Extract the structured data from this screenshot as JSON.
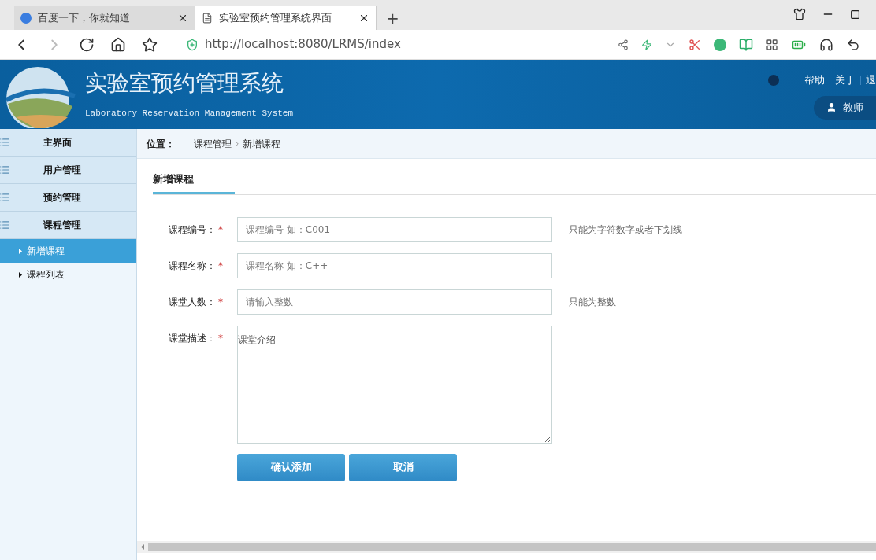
{
  "browser": {
    "tabs": [
      {
        "title": "百度一下，你就知道",
        "selected": false
      },
      {
        "title": "实验室预约管理系统界面",
        "selected": true
      }
    ],
    "new_tab": "+",
    "url": "http://localhost:8080/LRMS/index"
  },
  "header": {
    "title": "实验室预约管理系统",
    "subtitle": "Laboratory Reservation Management System",
    "links": [
      "帮助",
      "关于",
      "退"
    ],
    "user": "教师"
  },
  "sidebar": {
    "items": [
      {
        "label": "主界面",
        "kind": "section",
        "selected": false
      },
      {
        "label": "用户管理",
        "kind": "section",
        "selected": false
      },
      {
        "label": "预约管理",
        "kind": "section",
        "selected": false
      },
      {
        "label": "课程管理",
        "kind": "section",
        "selected": false
      },
      {
        "label": "新增课程",
        "kind": "sub",
        "selected": true
      },
      {
        "label": "课程列表",
        "kind": "sub",
        "selected": false
      }
    ]
  },
  "breadcrumb": {
    "label": "位置：",
    "items": [
      "课程管理",
      "新增课程"
    ]
  },
  "panel": {
    "title": "新增课程"
  },
  "form": {
    "fields": [
      {
        "label": "课程编号：",
        "required": "*",
        "kind": "input",
        "placeholder": "课程编号 如：C001",
        "hint": "只能为字符数字或者下划线"
      },
      {
        "label": "课程名称：",
        "required": "*",
        "kind": "input",
        "placeholder": "课程名称 如：C++"
      },
      {
        "label": "课堂人数：",
        "required": "*",
        "kind": "input",
        "placeholder": "请输入整数",
        "hint": "只能为整数"
      },
      {
        "label": "课堂描述：",
        "required": "*",
        "kind": "textarea",
        "value": "课堂介绍"
      }
    ],
    "buttons": [
      "确认添加",
      "取消"
    ]
  }
}
